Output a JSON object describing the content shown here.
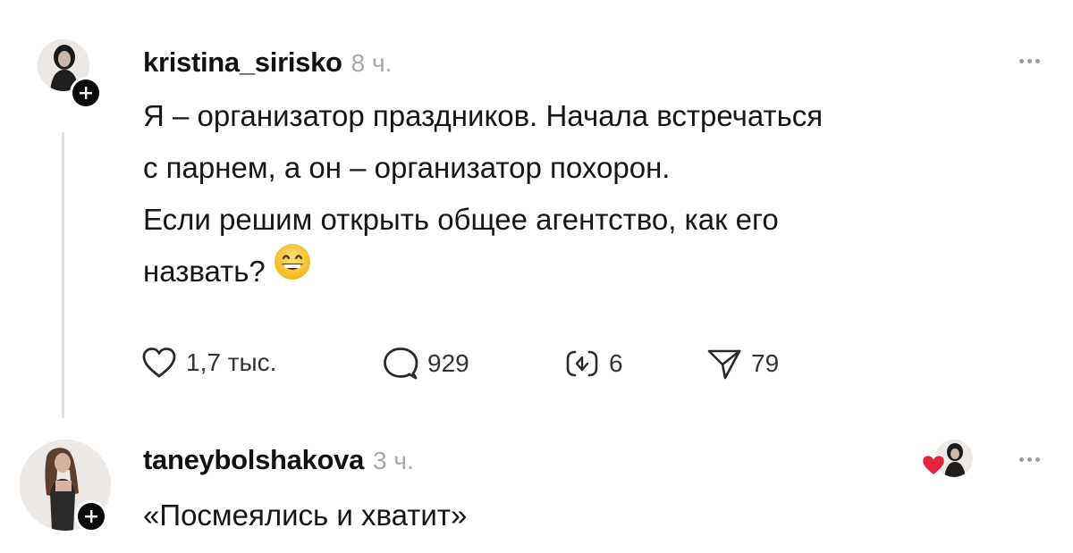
{
  "post": {
    "username": "kristina_sirisko",
    "time": "8 ч.",
    "text_lines": [
      "Я – организатор праздников. Начала встречаться",
      "с парнем, а он – организатор похорон.",
      "Если решим открыть общее агентство, как его",
      "назвать?"
    ],
    "emoji": "grinning-face",
    "actions": {
      "likes": "1,7 тыс.",
      "comments": "929",
      "reposts": "6",
      "shares": "79"
    }
  },
  "reply": {
    "username": "taneybolshakova",
    "time": "3 ч.",
    "text": "«Посмеялись и хватит»"
  },
  "icons": [
    "plus-icon",
    "more-icon",
    "heart-icon",
    "comment-icon",
    "repost-icon",
    "share-icon"
  ]
}
